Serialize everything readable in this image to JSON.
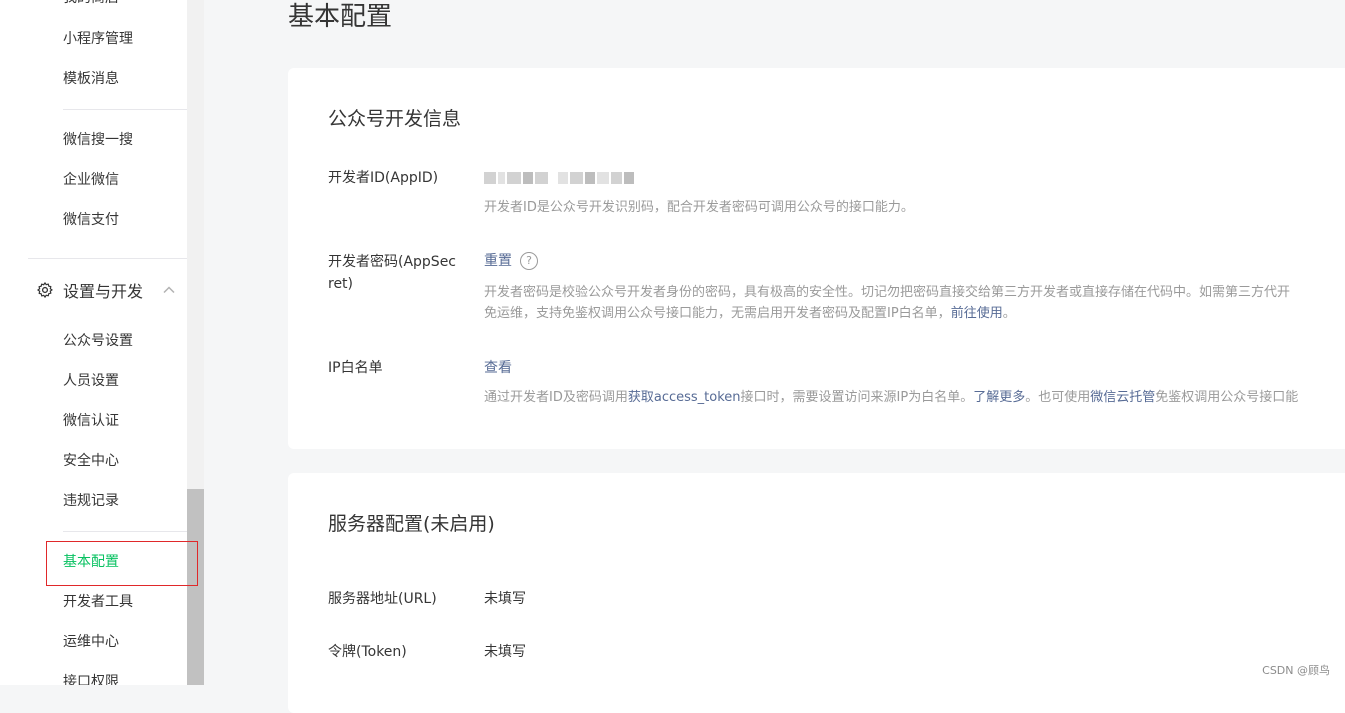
{
  "sidebar": {
    "items_top": [
      "我的商店",
      "小程序管理",
      "模板消息"
    ],
    "items_mid": [
      "微信搜一搜",
      "企业微信",
      "微信支付"
    ],
    "group": {
      "label": "设置与开发"
    },
    "items_settings": [
      "公众号设置",
      "人员设置",
      "微信认证",
      "安全中心",
      "违规记录"
    ],
    "items_dev": [
      "基本配置",
      "开发者工具",
      "运维中心",
      "接口权限"
    ]
  },
  "page": {
    "title": "基本配置"
  },
  "dev_info": {
    "title": "公众号开发信息",
    "appid": {
      "label": "开发者ID(AppID)",
      "desc": "开发者ID是公众号开发识别码，配合开发者密码可调用公众号的接口能力。"
    },
    "secret": {
      "label_1": "开发者密码(AppSec",
      "label_2": "ret)",
      "action": "重置",
      "help": "?",
      "desc_1": "开发者密码是校验公众号开发者身份的密码，具有极高的安全性。切记勿把密码直接交给第三方开发者或直接存储在代码中。如需第三方代开",
      "desc_2a": "免运维，支持免鉴权调用公众号接口能力，无需启用开发者密码及配置IP白名单，",
      "desc_2_link": "前往使用",
      "desc_2b": "。"
    },
    "ip": {
      "label": "IP白名单",
      "action": "查看",
      "desc_a": "通过开发者ID及密码调用",
      "desc_link1": "获取access_token",
      "desc_b": "接口时，需要设置访问来源IP为白名单。",
      "desc_link2": "了解更多",
      "desc_c": "。也可使用",
      "desc_link3": "微信云托管",
      "desc_d": "免鉴权调用公众号接口能"
    }
  },
  "server": {
    "title": "服务器配置(未启用)",
    "url": {
      "label": "服务器地址(URL)",
      "value": "未填写"
    },
    "token": {
      "label": "令牌(Token)",
      "value": "未填写"
    }
  },
  "watermark": "CSDN @顾鸟",
  "colors": {
    "accent": "#07c160",
    "link": "#576b95",
    "highlight_border": "#e0282a"
  }
}
